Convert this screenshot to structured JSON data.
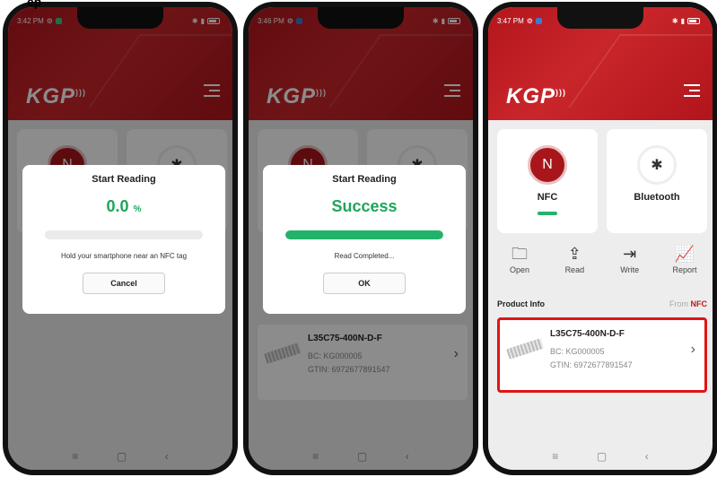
{
  "brand": {
    "logo": "KGP",
    "accent": "#b3161c",
    "success": "#1fa55a"
  },
  "cutoff_text": "ep",
  "screens": [
    {
      "time": "3:42 PM",
      "dialog": {
        "title": "Start Reading",
        "value": "0.0",
        "unit": "%",
        "progress": 0,
        "message": "Hold your smartphone near an NFC tag",
        "button": "Cancel"
      },
      "nav": [
        "≡",
        "▢",
        "‹"
      ]
    },
    {
      "time": "3:46 PM",
      "dialog": {
        "title": "Start Reading",
        "value": "Success",
        "progress": 1,
        "message": "Read Completed...",
        "button": "OK"
      },
      "product": {
        "name": "L35C75-400N-D-F",
        "bc": "BC: KG000005",
        "gtin": "GTIN: 6972677891547"
      },
      "nav": [
        "≡",
        "▢",
        "‹"
      ]
    },
    {
      "time": "3:47 PM",
      "cards": [
        {
          "label": "NFC",
          "icon": "nfc-icon",
          "glyph": "N"
        },
        {
          "label": "Bluetooth",
          "icon": "bluetooth-icon",
          "glyph": "✱"
        }
      ],
      "tools": [
        {
          "label": "Open",
          "icon": "folder-icon",
          "glyph": "🗀"
        },
        {
          "label": "Read",
          "icon": "upload-icon",
          "glyph": "⇪"
        },
        {
          "label": "Write",
          "icon": "import-icon",
          "glyph": "⇥"
        },
        {
          "label": "Report",
          "icon": "chart-icon",
          "glyph": "📈"
        }
      ],
      "info_title": "Product Info",
      "info_from": "From",
      "info_source": "NFC",
      "product": {
        "name": "L35C75-400N-D-F",
        "bc": "BC: KG000005",
        "gtin": "GTIN: 6972677891547"
      },
      "nav": [
        "≡",
        "▢",
        "‹"
      ]
    }
  ]
}
